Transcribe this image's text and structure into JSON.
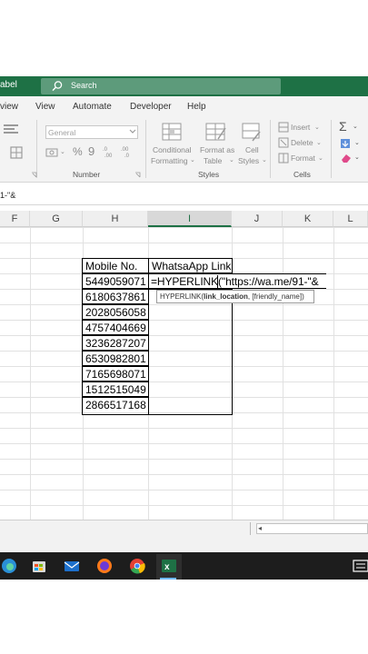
{
  "window": {
    "title_fragment": "abel"
  },
  "search": {
    "label": "Search"
  },
  "ribbon_tabs": [
    "view",
    "View",
    "Automate",
    "Developer",
    "Help"
  ],
  "ribbon": {
    "number_format": "General",
    "number_group": "Number",
    "styles_items": [
      "Conditional",
      "Formatting",
      "Format as",
      "Table",
      "Cell",
      "Styles"
    ],
    "styles_group": "Styles",
    "cells_items": [
      "Insert",
      "Delete",
      "Format"
    ],
    "cells_group": "Cells"
  },
  "formula_bar": {
    "text": "1-\"&"
  },
  "columns": [
    "F",
    "G",
    "H",
    "I",
    "J",
    "K",
    "L"
  ],
  "table": {
    "header_mobile": "Mobile No.",
    "header_link": "WhatsaApp Link",
    "rows": [
      "5449059071",
      "6180637861",
      "2028056058",
      "4757404669",
      "3236287207",
      "6530982801",
      "7165698071",
      "1512515049",
      "2866517168"
    ],
    "editing_formula": "=HYPERLINK(\"https://wa.me/91-\"&"
  },
  "tooltip": {
    "func": "HYPERLINK(",
    "arg1": "link_location",
    "rest": ", [friendly_name])"
  }
}
